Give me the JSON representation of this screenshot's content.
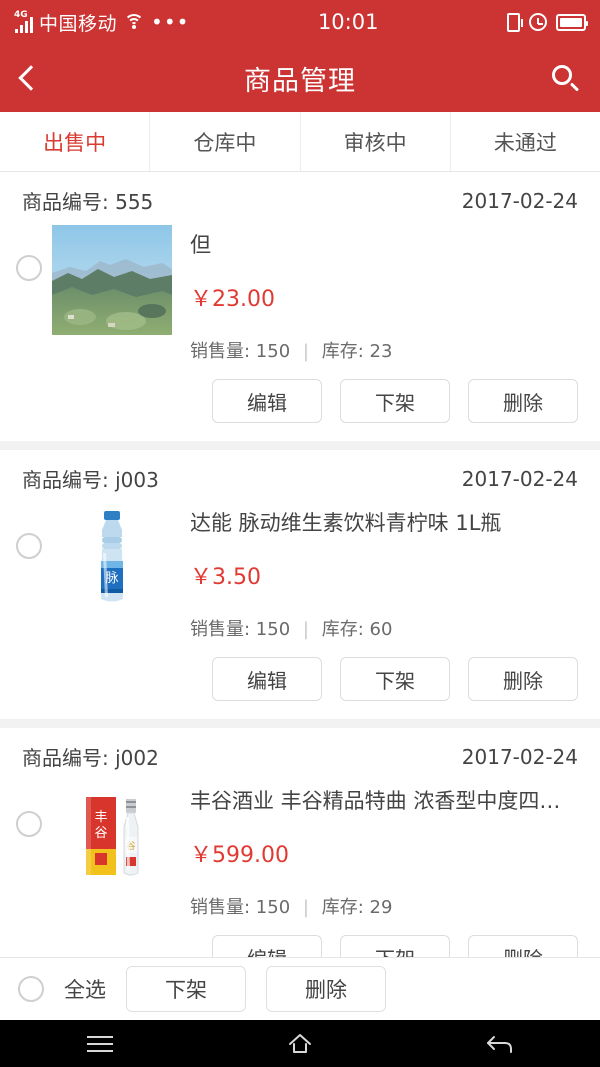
{
  "statusbar": {
    "network_type": "4G",
    "carrier": "中国移动",
    "dots": "•••",
    "time": "10:01",
    "icons": [
      "signal-icon",
      "wifi-icon",
      "more-dots-icon",
      "vibrate-icon",
      "alarm-icon",
      "battery-icon"
    ]
  },
  "header": {
    "title": "商品管理",
    "back_icon": "back-chevron-icon",
    "search_icon": "search-icon"
  },
  "tabs": [
    {
      "label": "出售中",
      "active": true
    },
    {
      "label": "仓库中",
      "active": false
    },
    {
      "label": "审核中",
      "active": false
    },
    {
      "label": "未通过",
      "active": false
    }
  ],
  "labels": {
    "code_prefix": "商品编号:",
    "sales_prefix": "销售量:",
    "stock_prefix": "库存:",
    "separator": "|",
    "currency": "￥"
  },
  "products": [
    {
      "code_label": "商品编号: 555",
      "date": "2017-02-24",
      "name": "但",
      "price": "￥23.00",
      "sales": "销售量: 150",
      "stock": "库存: 23",
      "thumb": "landscape-photo",
      "actions": [
        "编辑",
        "下架",
        "删除"
      ]
    },
    {
      "code_label": "商品编号: j003",
      "date": "2017-02-24",
      "name": "达能 脉动维生素饮料青柠味 1L瓶",
      "price": "￥3.50",
      "sales": "销售量: 150",
      "stock": "库存: 60",
      "thumb": "blue-beverage-bottle",
      "actions": [
        "编辑",
        "下架",
        "删除"
      ]
    },
    {
      "code_label": "商品编号: j002",
      "date": "2017-02-24",
      "name": "丰谷酒业 丰谷精品特曲 浓香型中度四…",
      "price": "￥599.00",
      "sales": "销售量: 150",
      "stock": "库存: 29",
      "thumb": "liquor-box-and-bottle",
      "actions": [
        "编辑",
        "下架",
        "删除"
      ]
    }
  ],
  "bottombar": {
    "select_all_label": "全选",
    "unlist_label": "下架",
    "delete_label": "删除"
  },
  "navbar": {
    "menu_icon": "menu-icon",
    "home_icon": "home-icon",
    "back_icon": "back-arrow-icon"
  },
  "colors": {
    "brand_red": "#cc3333",
    "price_red": "#e03a33",
    "tab_active": "#d93b33",
    "text": "#444444",
    "page_bg": "#f2f2f2"
  }
}
